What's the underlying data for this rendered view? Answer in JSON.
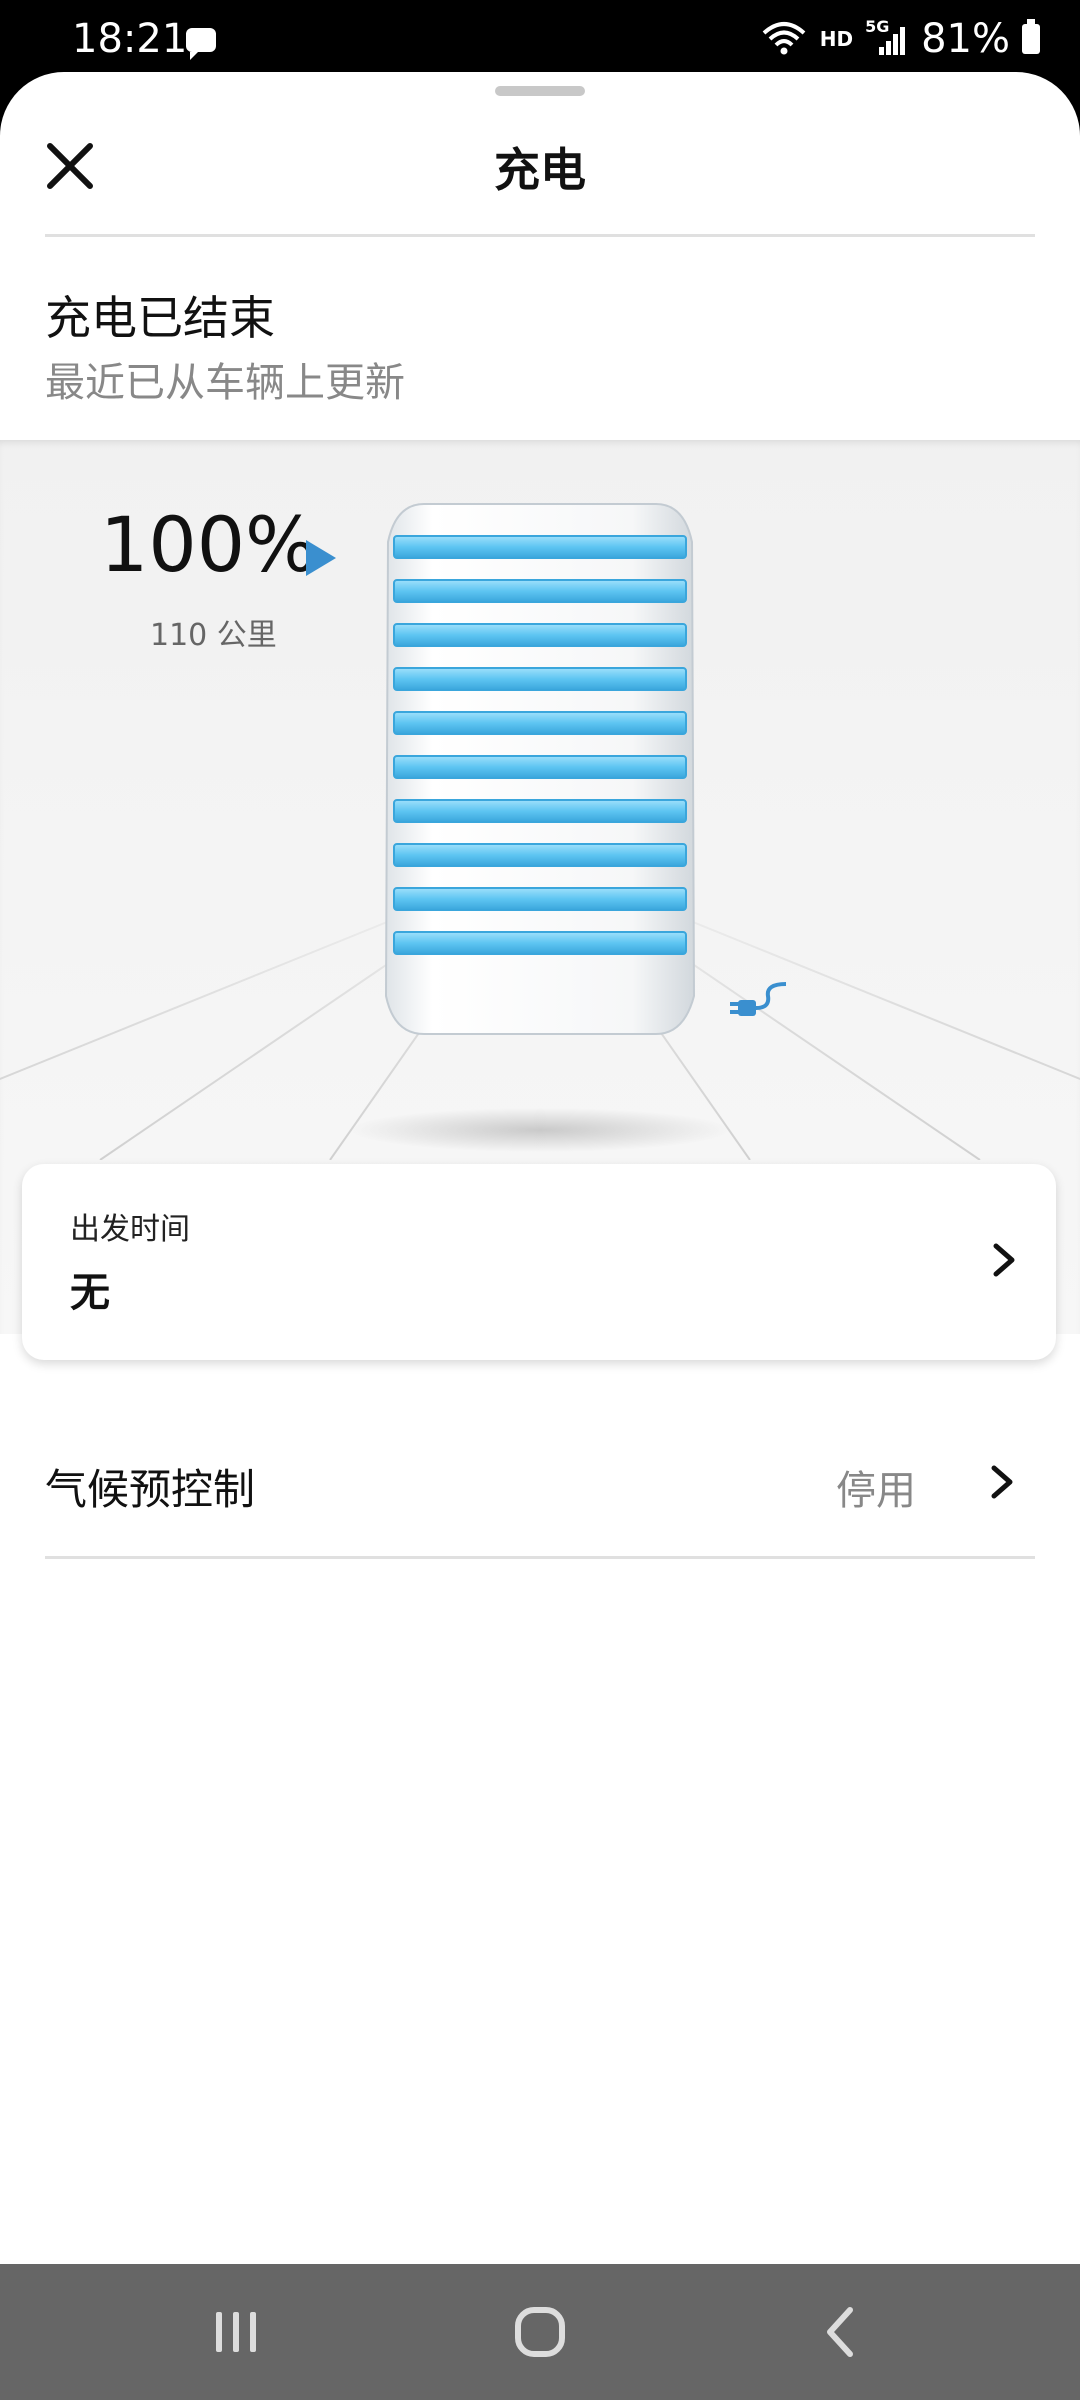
{
  "status_bar": {
    "time": "18:21",
    "network_hd": "HD",
    "network_type": "5G",
    "battery_level": "81%"
  },
  "header": {
    "title": "充电"
  },
  "status": {
    "title": "充电已结束",
    "subtitle": "最近已从车辆上更新"
  },
  "charge": {
    "percent_text": "100%",
    "level_percent": 100,
    "range": "110 公里",
    "bars": 10
  },
  "departure": {
    "label": "出发时间",
    "value": "无"
  },
  "climate": {
    "label": "气候预控制",
    "value": "停用"
  },
  "colors": {
    "accent_blue": "#3a8fcf",
    "bar_blue": "#63c6f1",
    "nav_bg": "#666666"
  }
}
